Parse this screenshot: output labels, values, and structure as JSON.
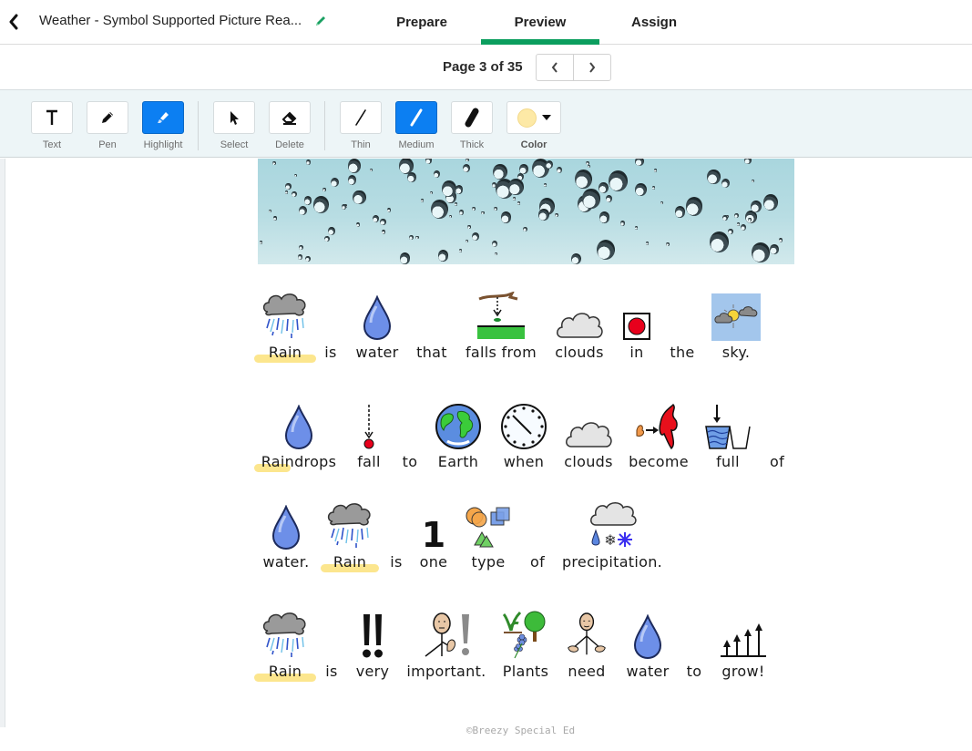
{
  "header": {
    "title": "Weather - Symbol Supported Picture Rea...",
    "back_icon": "chevron-left-icon",
    "edit_icon": "pencil-icon",
    "tabs": [
      {
        "label": "Prepare",
        "active": false
      },
      {
        "label": "Preview",
        "active": true
      },
      {
        "label": "Assign",
        "active": false
      }
    ],
    "accent_color": "#0b9e5e"
  },
  "pagination": {
    "label": "Page 3 of 35",
    "current": 3,
    "total": 35,
    "prev_icon": "chevron-left-icon",
    "next_icon": "chevron-right-icon"
  },
  "toolbar": {
    "tools": [
      {
        "label": "Text",
        "icon": "text-icon",
        "active": false
      },
      {
        "label": "Pen",
        "icon": "pen-icon",
        "active": false
      },
      {
        "label": "Highlight",
        "icon": "highlighter-icon",
        "active": true
      },
      {
        "label": "Select",
        "icon": "cursor-icon",
        "active": false
      },
      {
        "label": "Delete",
        "icon": "eraser-icon",
        "active": false
      },
      {
        "label": "Thin",
        "icon": "thin-line-icon",
        "active": false
      },
      {
        "label": "Medium",
        "icon": "medium-line-icon",
        "active": true
      },
      {
        "label": "Thick",
        "icon": "thick-line-icon",
        "active": false
      }
    ],
    "color": {
      "label": "Color",
      "value": "#fde9a6",
      "icon": "caret-down-icon"
    },
    "active_color": "#0c7ff2"
  },
  "document": {
    "header_image": "raindrops-on-glass",
    "rows": [
      {
        "words": [
          {
            "text": "Rain",
            "symbol": "rain-cloud",
            "highlighted": "Rain"
          },
          {
            "text": "is",
            "symbol": ""
          },
          {
            "text": "water",
            "symbol": "water-drop"
          },
          {
            "text": "that",
            "symbol": ""
          },
          {
            "text": "falls from",
            "symbol": "falls-from"
          },
          {
            "text": "clouds",
            "symbol": "cloud"
          },
          {
            "text": "in",
            "symbol": "in-box"
          },
          {
            "text": "the",
            "symbol": ""
          },
          {
            "text": "sky.",
            "symbol": "sky"
          }
        ]
      },
      {
        "words": [
          {
            "text": "Raindrops",
            "symbol": "water-drop",
            "highlighted": "Rain"
          },
          {
            "text": "fall",
            "symbol": "fall-arrow"
          },
          {
            "text": "to",
            "symbol": ""
          },
          {
            "text": "Earth",
            "symbol": "earth"
          },
          {
            "text": "when",
            "symbol": "clock"
          },
          {
            "text": "clouds",
            "symbol": "cloud"
          },
          {
            "text": "become",
            "symbol": "become"
          },
          {
            "text": "full",
            "symbol": "full-container"
          },
          {
            "text": "of",
            "symbol": ""
          }
        ]
      },
      {
        "words": [
          {
            "text": "water.",
            "symbol": "water-drop"
          },
          {
            "text": "Rain",
            "symbol": "rain-cloud",
            "highlighted": "Rain"
          },
          {
            "text": "is",
            "symbol": ""
          },
          {
            "text": "one",
            "symbol": "number-one"
          },
          {
            "text": "type",
            "symbol": "shapes"
          },
          {
            "text": "of",
            "symbol": ""
          },
          {
            "text": "precipitation.",
            "symbol": "precipitation"
          }
        ]
      },
      {
        "words": [
          {
            "text": "Rain",
            "symbol": "rain-cloud",
            "highlighted": "Rain"
          },
          {
            "text": "is",
            "symbol": ""
          },
          {
            "text": "very",
            "symbol": "double-exclamation"
          },
          {
            "text": "important.",
            "symbol": "important-person"
          },
          {
            "text": "Plants",
            "symbol": "plants"
          },
          {
            "text": "need",
            "symbol": "need-person"
          },
          {
            "text": "water",
            "symbol": "water-drop"
          },
          {
            "text": "to",
            "symbol": ""
          },
          {
            "text": "grow!",
            "symbol": "grow-arrows"
          }
        ]
      }
    ],
    "highlight_color": "#fbe27a",
    "footer": "©Breezy Special Ed"
  }
}
